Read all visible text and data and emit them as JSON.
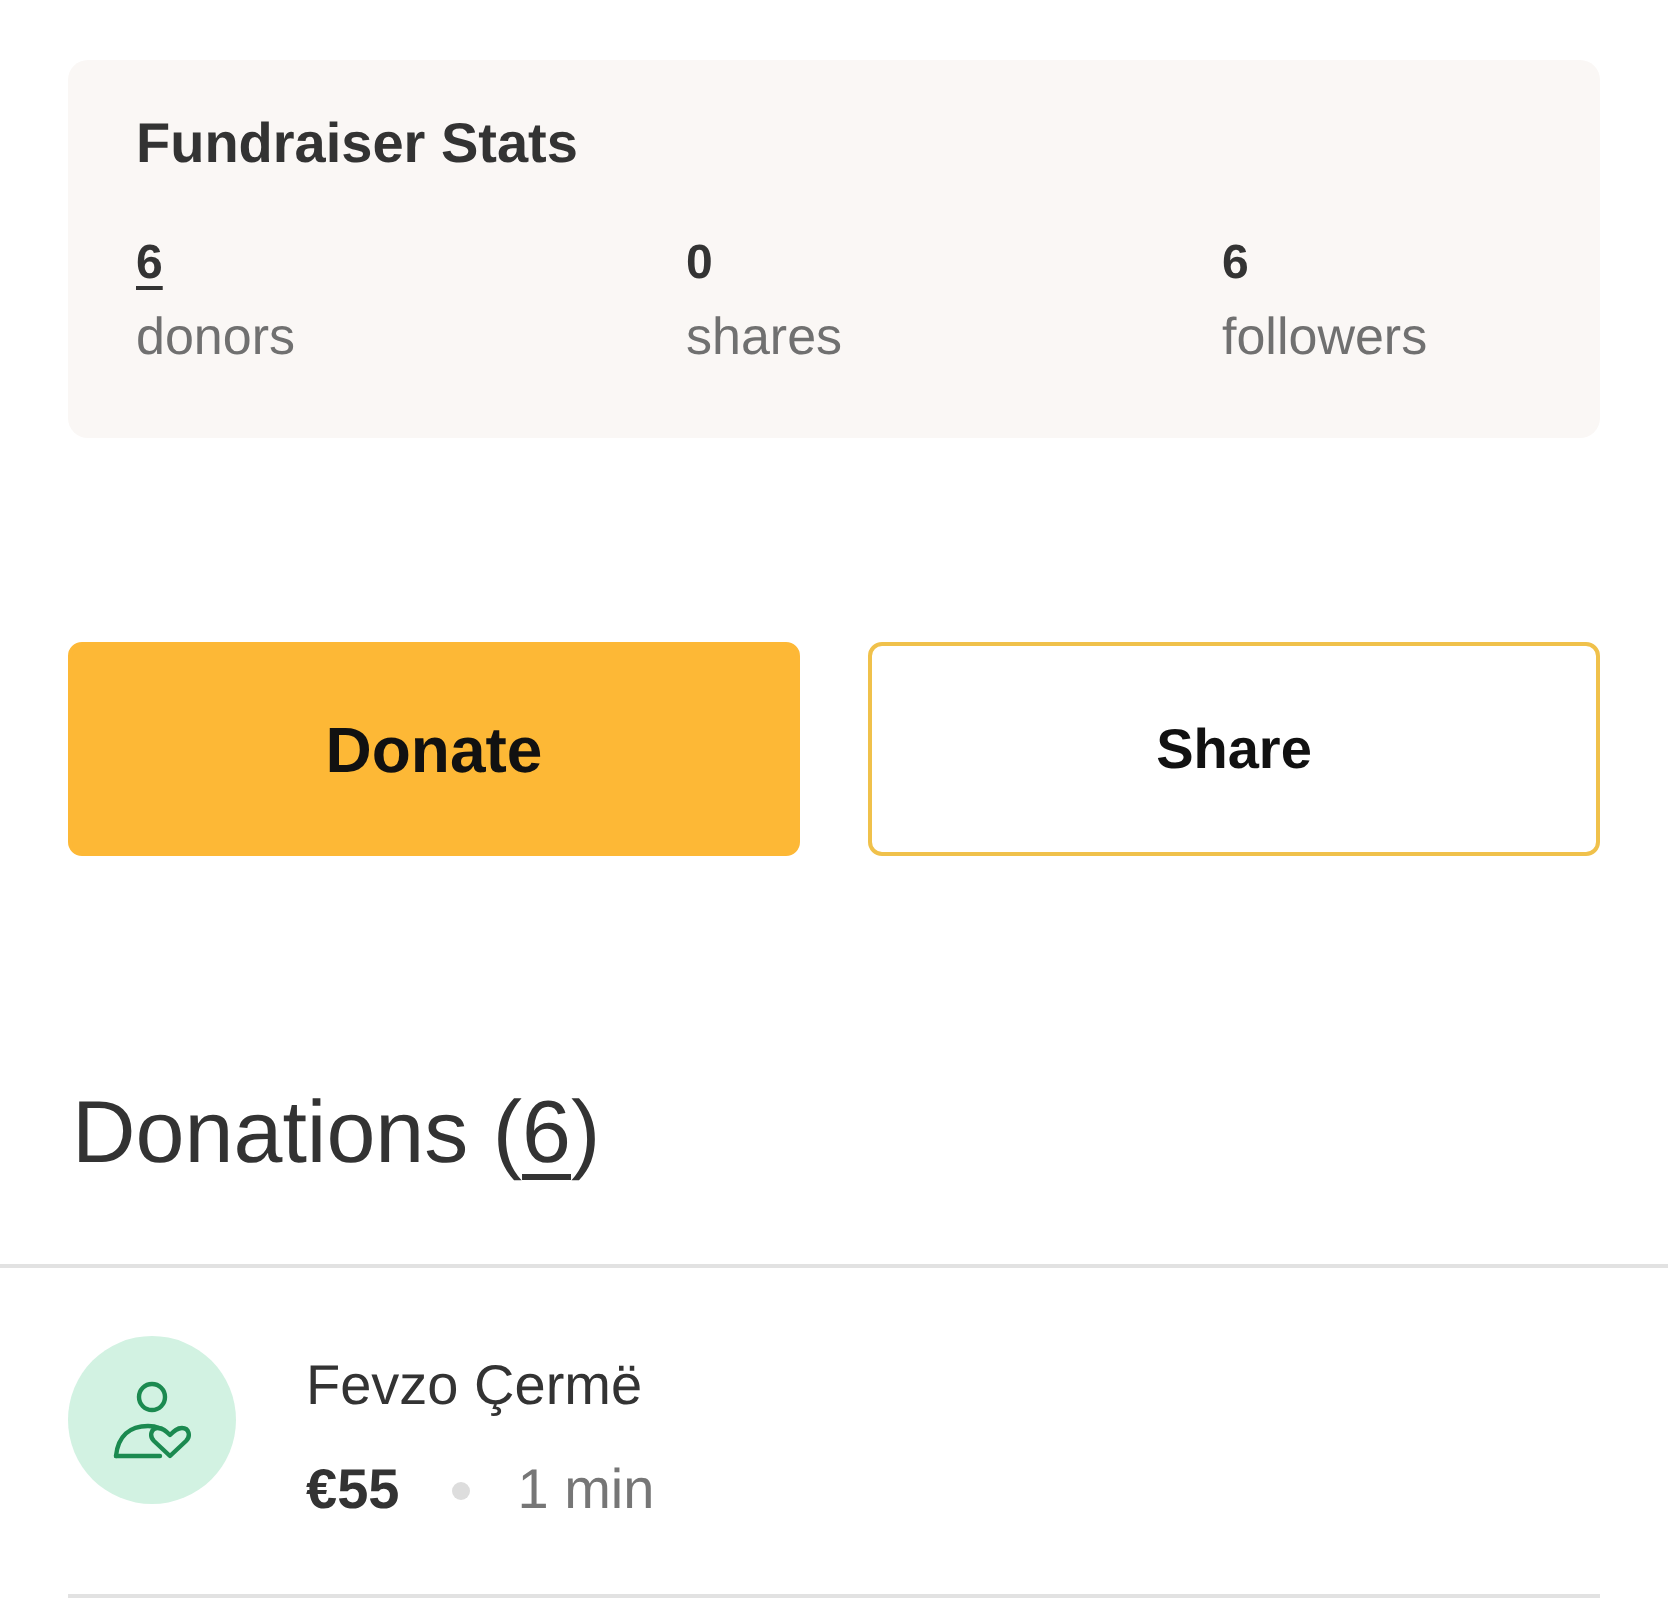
{
  "stats": {
    "title": "Fundraiser Stats",
    "items": [
      {
        "value": "6",
        "label": "donors",
        "kind": "link"
      },
      {
        "value": "0",
        "label": "shares",
        "kind": "plain"
      },
      {
        "value": "6",
        "label": "followers",
        "kind": "plain"
      }
    ]
  },
  "buttons": [
    {
      "label": "Donate",
      "kind": "primary"
    },
    {
      "label": "Share",
      "kind": "outline"
    }
  ],
  "donations": {
    "title_prefix": "Donations (",
    "count": "6",
    "title_suffix": ")",
    "items": [
      {
        "name": "Fevzo Çermë",
        "amount": "€55",
        "time": "1 min"
      }
    ]
  }
}
